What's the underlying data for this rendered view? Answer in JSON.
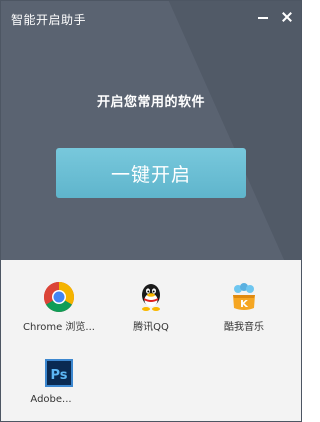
{
  "window": {
    "title": "智能开启助手",
    "minimize_icon": "minimize-icon",
    "close_icon": "close-icon"
  },
  "main": {
    "subtitle": "开启您常用的软件",
    "open_button_label": "一键开启",
    "accent_color": "#6ec1d8"
  },
  "apps": [
    {
      "label": "Chrome 浏览...",
      "icon": "chrome-icon"
    },
    {
      "label": "腾讯QQ",
      "icon": "qq-penguin-icon"
    },
    {
      "label": "酷我音乐",
      "icon": "kuwo-music-icon"
    },
    {
      "label": "Adobe...",
      "icon": "photoshop-icon",
      "icon_text": "Ps"
    }
  ]
}
